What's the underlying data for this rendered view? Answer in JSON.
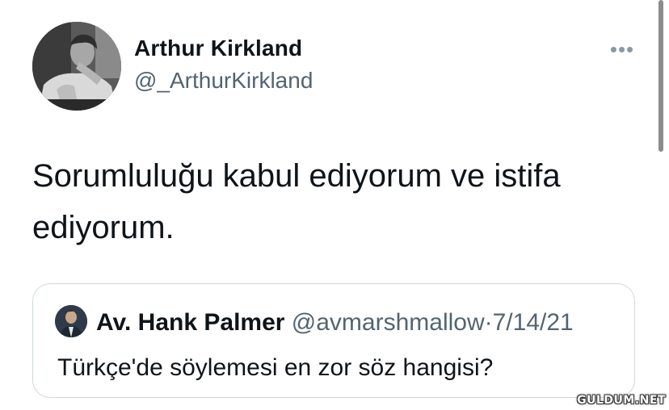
{
  "author": {
    "name": "Arthur Kirkland",
    "handle": "@_ArthurKirkland"
  },
  "more_icon": "more-horizontal-icon",
  "tweet": {
    "text": "Sorumluluğu kabul ediyorum ve istifa ediyorum."
  },
  "quoted_tweet": {
    "name": "Av. Hank Palmer",
    "handle": "@avmarshmallow",
    "separator": "·",
    "date": "7/14/21",
    "text": "Türkçe'de söylemesi en zor söz hangisi?"
  },
  "watermark": "GULDUM.NET"
}
